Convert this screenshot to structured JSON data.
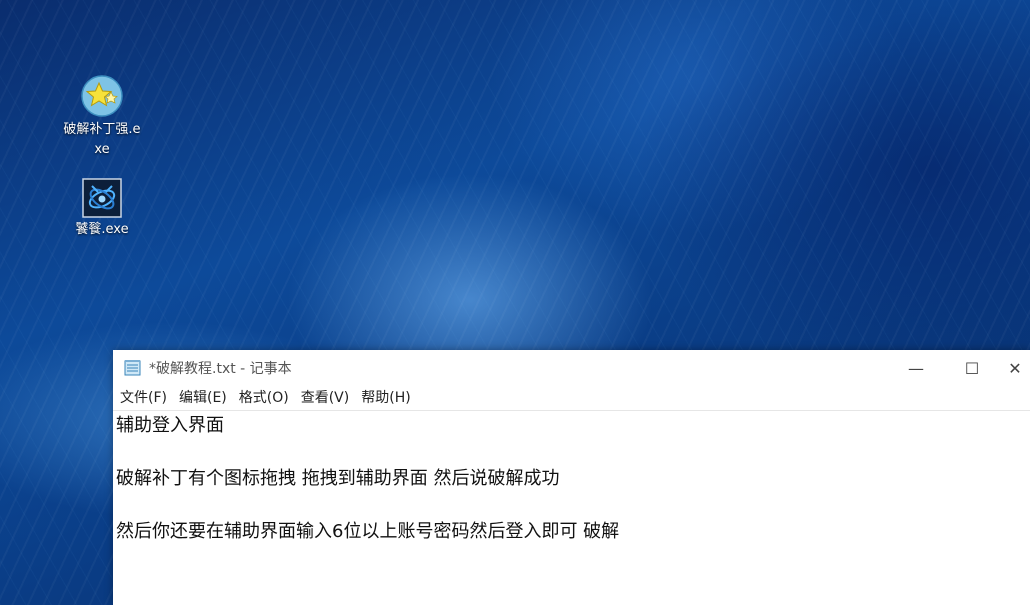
{
  "desktop": {
    "icons": [
      {
        "label": "破解补丁强.exe",
        "icon": "star-app-icon"
      },
      {
        "label": "饕餮.exe",
        "icon": "taotie-app-icon"
      }
    ]
  },
  "notepad": {
    "title": "*破解教程.txt - 记事本",
    "controls": {
      "minimize": "—",
      "maximize": "☐",
      "close": "✕"
    },
    "menu": [
      "文件(F)",
      "编辑(E)",
      "格式(O)",
      "查看(V)",
      "帮助(H)"
    ],
    "lines": [
      "辅助登入界面",
      "",
      "破解补丁有个图标拖拽 拖拽到辅助界面 然后说破解成功",
      "",
      "然后你还要在辅助界面输入6位以上账号密码然后登入即可 破解"
    ]
  }
}
